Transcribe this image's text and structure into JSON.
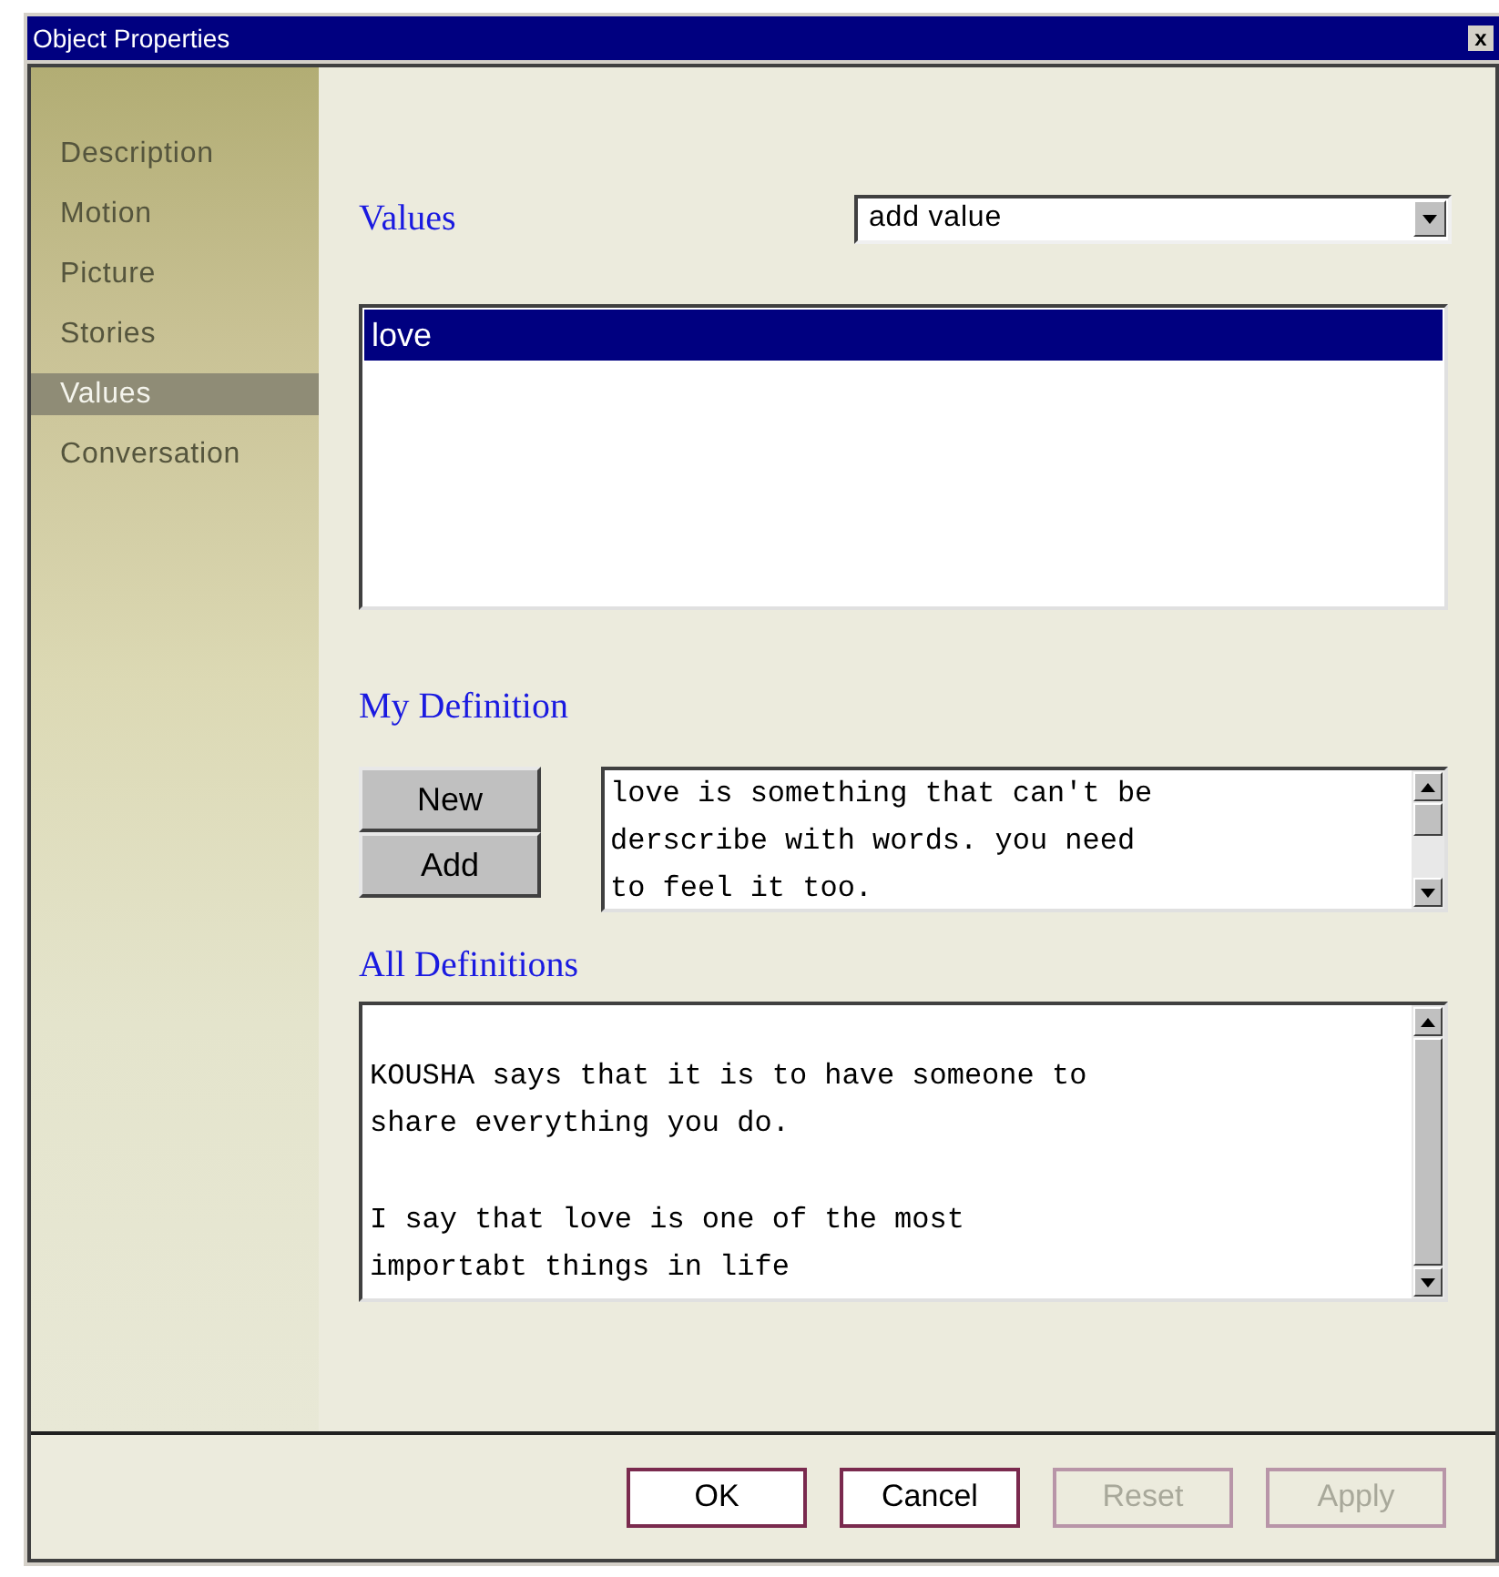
{
  "window": {
    "title": "Object Properties",
    "close": "x"
  },
  "sidebar": {
    "items": [
      {
        "label": "Description",
        "selected": false
      },
      {
        "label": "Motion",
        "selected": false
      },
      {
        "label": "Picture",
        "selected": false
      },
      {
        "label": "Stories",
        "selected": false
      },
      {
        "label": "Values",
        "selected": true
      },
      {
        "label": "Conversation",
        "selected": false
      }
    ]
  },
  "values": {
    "heading": "Values",
    "dropdown": {
      "value": "add value"
    },
    "list": [
      {
        "label": "love",
        "selected": true
      }
    ]
  },
  "my_definition": {
    "heading": "My Definition",
    "buttons": [
      "New",
      "Add"
    ],
    "text": "love is something that can't be\nderscribe with words. you need\nto feel it too."
  },
  "all_definitions": {
    "heading": "All Definitions",
    "paragraphs": [
      "KOUSHA says that it is to have someone to\nshare everything you do.",
      "I say that love is one of the most\nimportabt things in life"
    ]
  },
  "buttons": [
    {
      "label": "OK",
      "disabled": false
    },
    {
      "label": "Cancel",
      "disabled": false
    },
    {
      "label": "Reset",
      "disabled": true
    },
    {
      "label": "Apply",
      "disabled": true
    }
  ]
}
